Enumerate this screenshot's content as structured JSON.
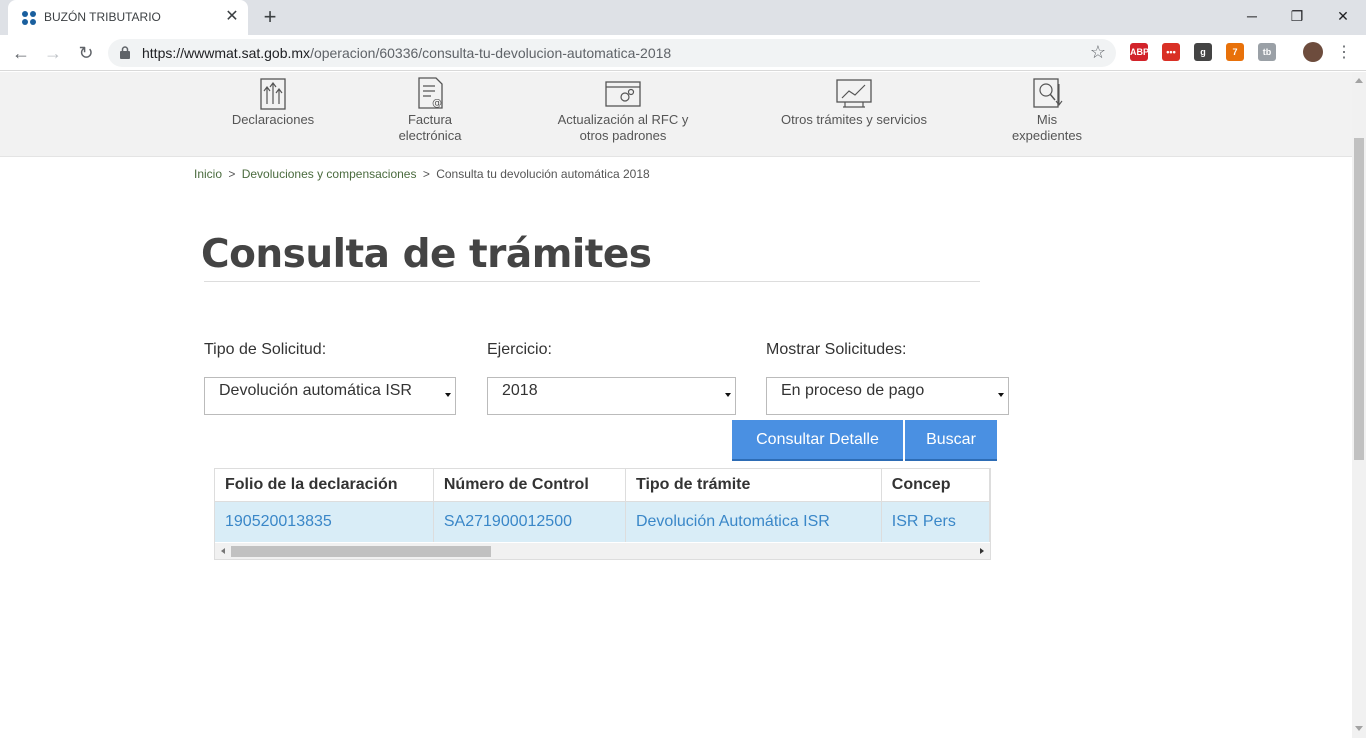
{
  "browser": {
    "tab_title": "BUZÓN TRIBUTARIO",
    "url_host": "https://wwwmat.sat.gob.mx",
    "url_path": "/operacion/60336/consulta-tu-devolucion-automatica-2018",
    "extensions": [
      {
        "name": "adblock-plus-icon",
        "text": "ABP",
        "color": "#d2232a"
      },
      {
        "name": "extension-red-icon",
        "text": "•••",
        "color": "#d93025"
      },
      {
        "name": "grammarly-icon",
        "text": "g",
        "color": "#444444"
      },
      {
        "name": "feed-icon",
        "text": "7",
        "color": "#e8710a"
      },
      {
        "name": "tb-icon",
        "text": "tb",
        "color": "#9aa0a6"
      }
    ]
  },
  "satnav": {
    "items": [
      {
        "label_1": "Declaraciones",
        "label_2": ""
      },
      {
        "label_1": "Factura",
        "label_2": "electrónica"
      },
      {
        "label_1": "Actualización al RFC y",
        "label_2": "otros padrones"
      },
      {
        "label_1": "Otros trámites y servicios",
        "label_2": ""
      },
      {
        "label_1": "Mis",
        "label_2": "expedientes"
      }
    ]
  },
  "breadcrumb": {
    "home": "Inicio",
    "section": "Devoluciones y compensaciones",
    "current": "Consulta tu devolución automática 2018",
    "sep": ">"
  },
  "page": {
    "title": "Consulta de trámites"
  },
  "form": {
    "tipo_label": "Tipo de Solicitud:",
    "tipo_value": "Devolución automática ISR",
    "ejercicio_label": "Ejercicio:",
    "ejercicio_value": "2018",
    "mostrar_label": "Mostrar Solicitudes:",
    "mostrar_value": "En proceso de pago",
    "consultar_label": "Consultar Detalle",
    "buscar_label": "Buscar"
  },
  "table": {
    "headers": [
      "Folio de la declaración",
      "Número de Control",
      "Tipo de trámite",
      "Concep"
    ],
    "rows": [
      [
        "190520013835",
        "SA271900012500",
        "Devolución Automática ISR",
        "ISR Pers"
      ]
    ]
  },
  "colors": {
    "button": "#4a90e2",
    "row_highlight": "#d9edf7",
    "link": "#3a87c8"
  }
}
